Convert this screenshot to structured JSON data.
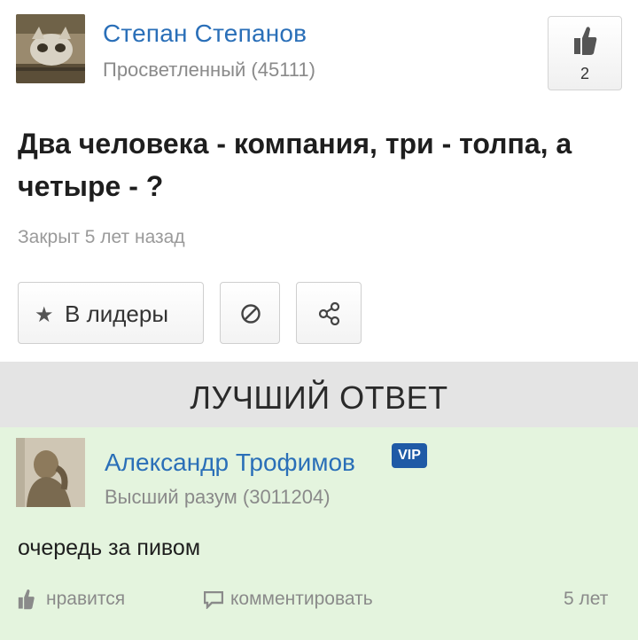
{
  "question": {
    "author": {
      "name": "Степан Степанов",
      "rank": "Просветленный (45111)"
    },
    "likes": "2",
    "title": "Два человека - компания, три - толпа, а четыре - ?",
    "meta": "Закрыт 5 лет назад",
    "buttons": {
      "leaders_label": "В лидеры"
    }
  },
  "best_answer": {
    "header": "ЛУЧШИЙ ОТВЕТ",
    "author": {
      "name": "Александр Трофимов",
      "badge": "VIP",
      "rank": "Высший разум (3011204)"
    },
    "text": "очередь за пивом",
    "actions": {
      "like_label": "нравится",
      "comment_label": "комментировать",
      "time": "5 лет"
    }
  },
  "colors": {
    "link": "#2a6fb8",
    "muted": "#8a8a8a",
    "answer_bg": "#e4f4de",
    "header_bg": "#e4e4e4",
    "vip_bg": "#1f5aa6"
  },
  "icons": [
    "thumbs-up-icon",
    "star-icon",
    "block-icon",
    "share-icon",
    "comment-icon"
  ]
}
